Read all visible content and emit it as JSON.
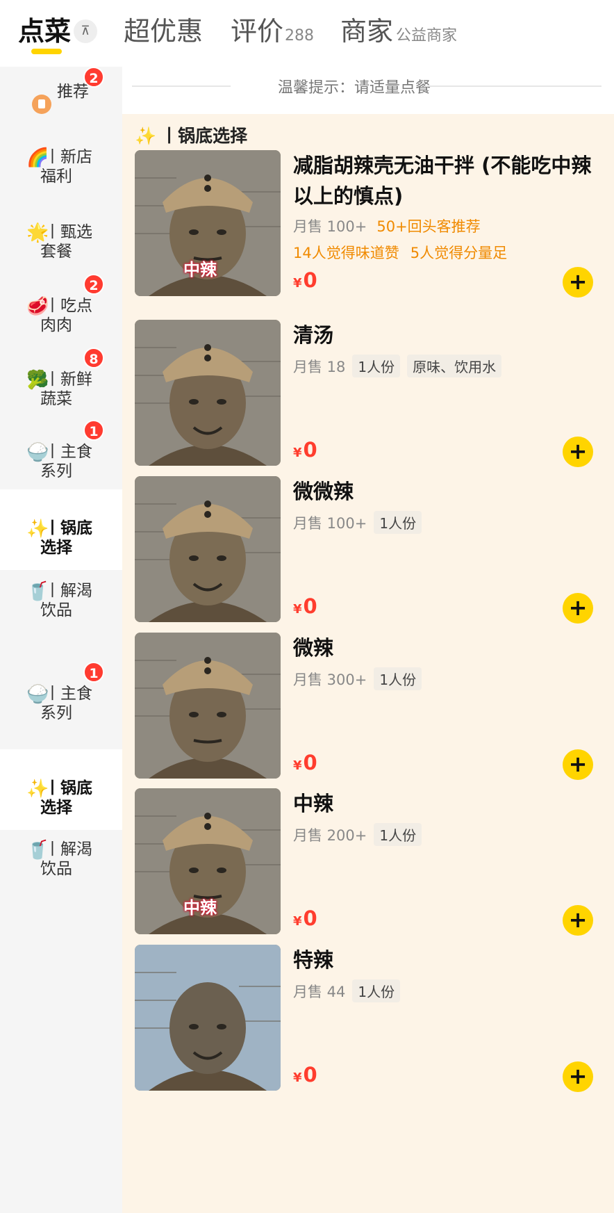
{
  "tabs": [
    {
      "label": "点菜"
    },
    {
      "label": "超优惠"
    },
    {
      "label": "评价",
      "count": "288"
    },
    {
      "label": "商家",
      "sub": "公益商家"
    }
  ],
  "sidebar": {
    "items": [
      {
        "emoji": "",
        "line1": "推荐",
        "line2": "",
        "badge": "2"
      },
      {
        "emoji": "🌈",
        "line1": "丨新店",
        "line2": "福利",
        "badge": ""
      },
      {
        "emoji": "🌟",
        "line1": "丨甄选",
        "line2": "套餐",
        "badge": ""
      },
      {
        "emoji": "🥩",
        "line1": "丨吃点",
        "line2": "肉肉",
        "badge": "2"
      },
      {
        "emoji": "🥦",
        "line1": "丨新鲜",
        "line2": "蔬菜",
        "badge": "8"
      },
      {
        "emoji": "🍚",
        "line1": "丨主食",
        "line2": "系列",
        "badge": "1"
      },
      {
        "emoji": "✨",
        "line1": "丨锅底",
        "line2": "选择",
        "badge": "",
        "active": true
      },
      {
        "emoji": "🥤",
        "line1": "丨解渴",
        "line2": "饮品",
        "badge": ""
      },
      {
        "emoji": "🍚",
        "line1": "丨主食",
        "line2": "系列",
        "badge": "1"
      },
      {
        "emoji": "✨",
        "line1": "丨锅底",
        "line2": "选择",
        "badge": "",
        "active": true
      },
      {
        "emoji": "🥤",
        "line1": "丨解渴",
        "line2": "饮品",
        "badge": ""
      }
    ]
  },
  "content": {
    "tip": "温馨提示：请适量点餐",
    "section_title_emoji": "✨",
    "section_title": "丨锅底选择",
    "items": [
      {
        "name": "减脂胡辣壳无油干拌 (不能吃中辣以上的慎点)",
        "sales": "月售 100+",
        "chips": [],
        "highlight": "50+回头客推荐",
        "tags": [
          "14人觉得味道赞",
          "5人觉得分量足"
        ],
        "price": "0",
        "thumb_caption": "中辣"
      },
      {
        "name": "清汤",
        "sales": "月售 18",
        "chips": [
          "1人份",
          "原味、饮用水"
        ],
        "highlight": "",
        "tags": [],
        "price": "0",
        "thumb_caption": ""
      },
      {
        "name": "微微辣",
        "sales": "月售 100+",
        "chips": [
          "1人份"
        ],
        "highlight": "",
        "tags": [],
        "price": "0",
        "thumb_caption": ""
      },
      {
        "name": "微辣",
        "sales": "月售 300+",
        "chips": [
          "1人份"
        ],
        "highlight": "",
        "tags": [],
        "price": "0",
        "thumb_caption": ""
      },
      {
        "name": "中辣",
        "sales": "月售 200+",
        "chips": [
          "1人份"
        ],
        "highlight": "",
        "tags": [],
        "price": "0",
        "thumb_caption": "中辣"
      },
      {
        "name": "特辣",
        "sales": "月售 44",
        "chips": [
          "1人份"
        ],
        "highlight": "",
        "tags": [],
        "price": "0",
        "thumb_caption": ""
      }
    ]
  },
  "icons": {
    "sort": "sort-icon",
    "add": "plus-icon",
    "recommend": "bookmark-icon"
  },
  "colors": {
    "accent": "#ffd400",
    "price": "#ff3d2e",
    "highlight": "#f08a00",
    "badge": "#ff3b30",
    "content_bg": "#fdf4e7"
  }
}
